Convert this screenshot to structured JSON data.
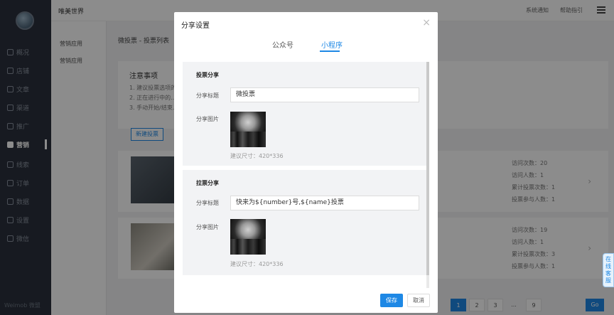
{
  "sidebar": {
    "items": [
      {
        "label": "概况",
        "icon": "chart-icon"
      },
      {
        "label": "店铺",
        "icon": "shop-icon"
      },
      {
        "label": "文章",
        "icon": "article-icon"
      },
      {
        "label": "渠道",
        "icon": "channel-icon"
      },
      {
        "label": "推广",
        "icon": "promote-icon"
      },
      {
        "label": "营销",
        "icon": "marketing-icon"
      },
      {
        "label": "线索",
        "icon": "lead-icon"
      },
      {
        "label": "订单",
        "icon": "order-icon"
      },
      {
        "label": "数据",
        "icon": "data-icon"
      },
      {
        "label": "设置",
        "icon": "settings-icon"
      },
      {
        "label": "微信",
        "icon": "wechat-icon"
      }
    ],
    "active": "营销",
    "footer": "Weimob 微盟"
  },
  "subbar": {
    "items": [
      "营销应用",
      "营销应用"
    ]
  },
  "topbar": {
    "title": "唯美世界",
    "notice_link": "系统通知",
    "help_link": "帮助指引"
  },
  "main": {
    "breadcrumb": "微投票 - 投票列表",
    "notice_title": "注意事项",
    "notice_lines": [
      "1. 建议投票选项的...",
      "2. 正在进行中的...",
      "3. 手动开始/结束..."
    ],
    "new_button": "新建投票",
    "cards": [
      {
        "stats": [
          "访问次数：20",
          "访问人数：1",
          "累计投票次数：1",
          "投票参与人数：1"
        ]
      },
      {
        "stats": [
          "访问次数：19",
          "访问人数：1",
          "累计投票次数：3",
          "投票参与人数：1"
        ]
      }
    ],
    "pager": [
      "1",
      "2",
      "3",
      "...",
      "9"
    ],
    "go_label": "Go"
  },
  "service_float": "在线客服",
  "modal": {
    "title": "分享设置",
    "close_icon": "close-icon",
    "tabs": [
      "公众号",
      "小程序"
    ],
    "active_tab": "小程序",
    "vote_share": {
      "section_title": "投票分享",
      "title_label": "分享标题",
      "title_value": "微投票",
      "image_label": "分享图片",
      "size_hint": "建议尺寸：420*336"
    },
    "canvass_share": {
      "section_title": "拉票分享",
      "title_label": "分享标题",
      "title_value": "快来为${number}号,${name}投票",
      "image_label": "分享图片",
      "size_hint": "建议尺寸：420*336"
    },
    "save_button": "保存",
    "cancel_button": "取消"
  },
  "colors": {
    "primary": "#1e88e5",
    "sidebar_bg": "#2b313c"
  }
}
